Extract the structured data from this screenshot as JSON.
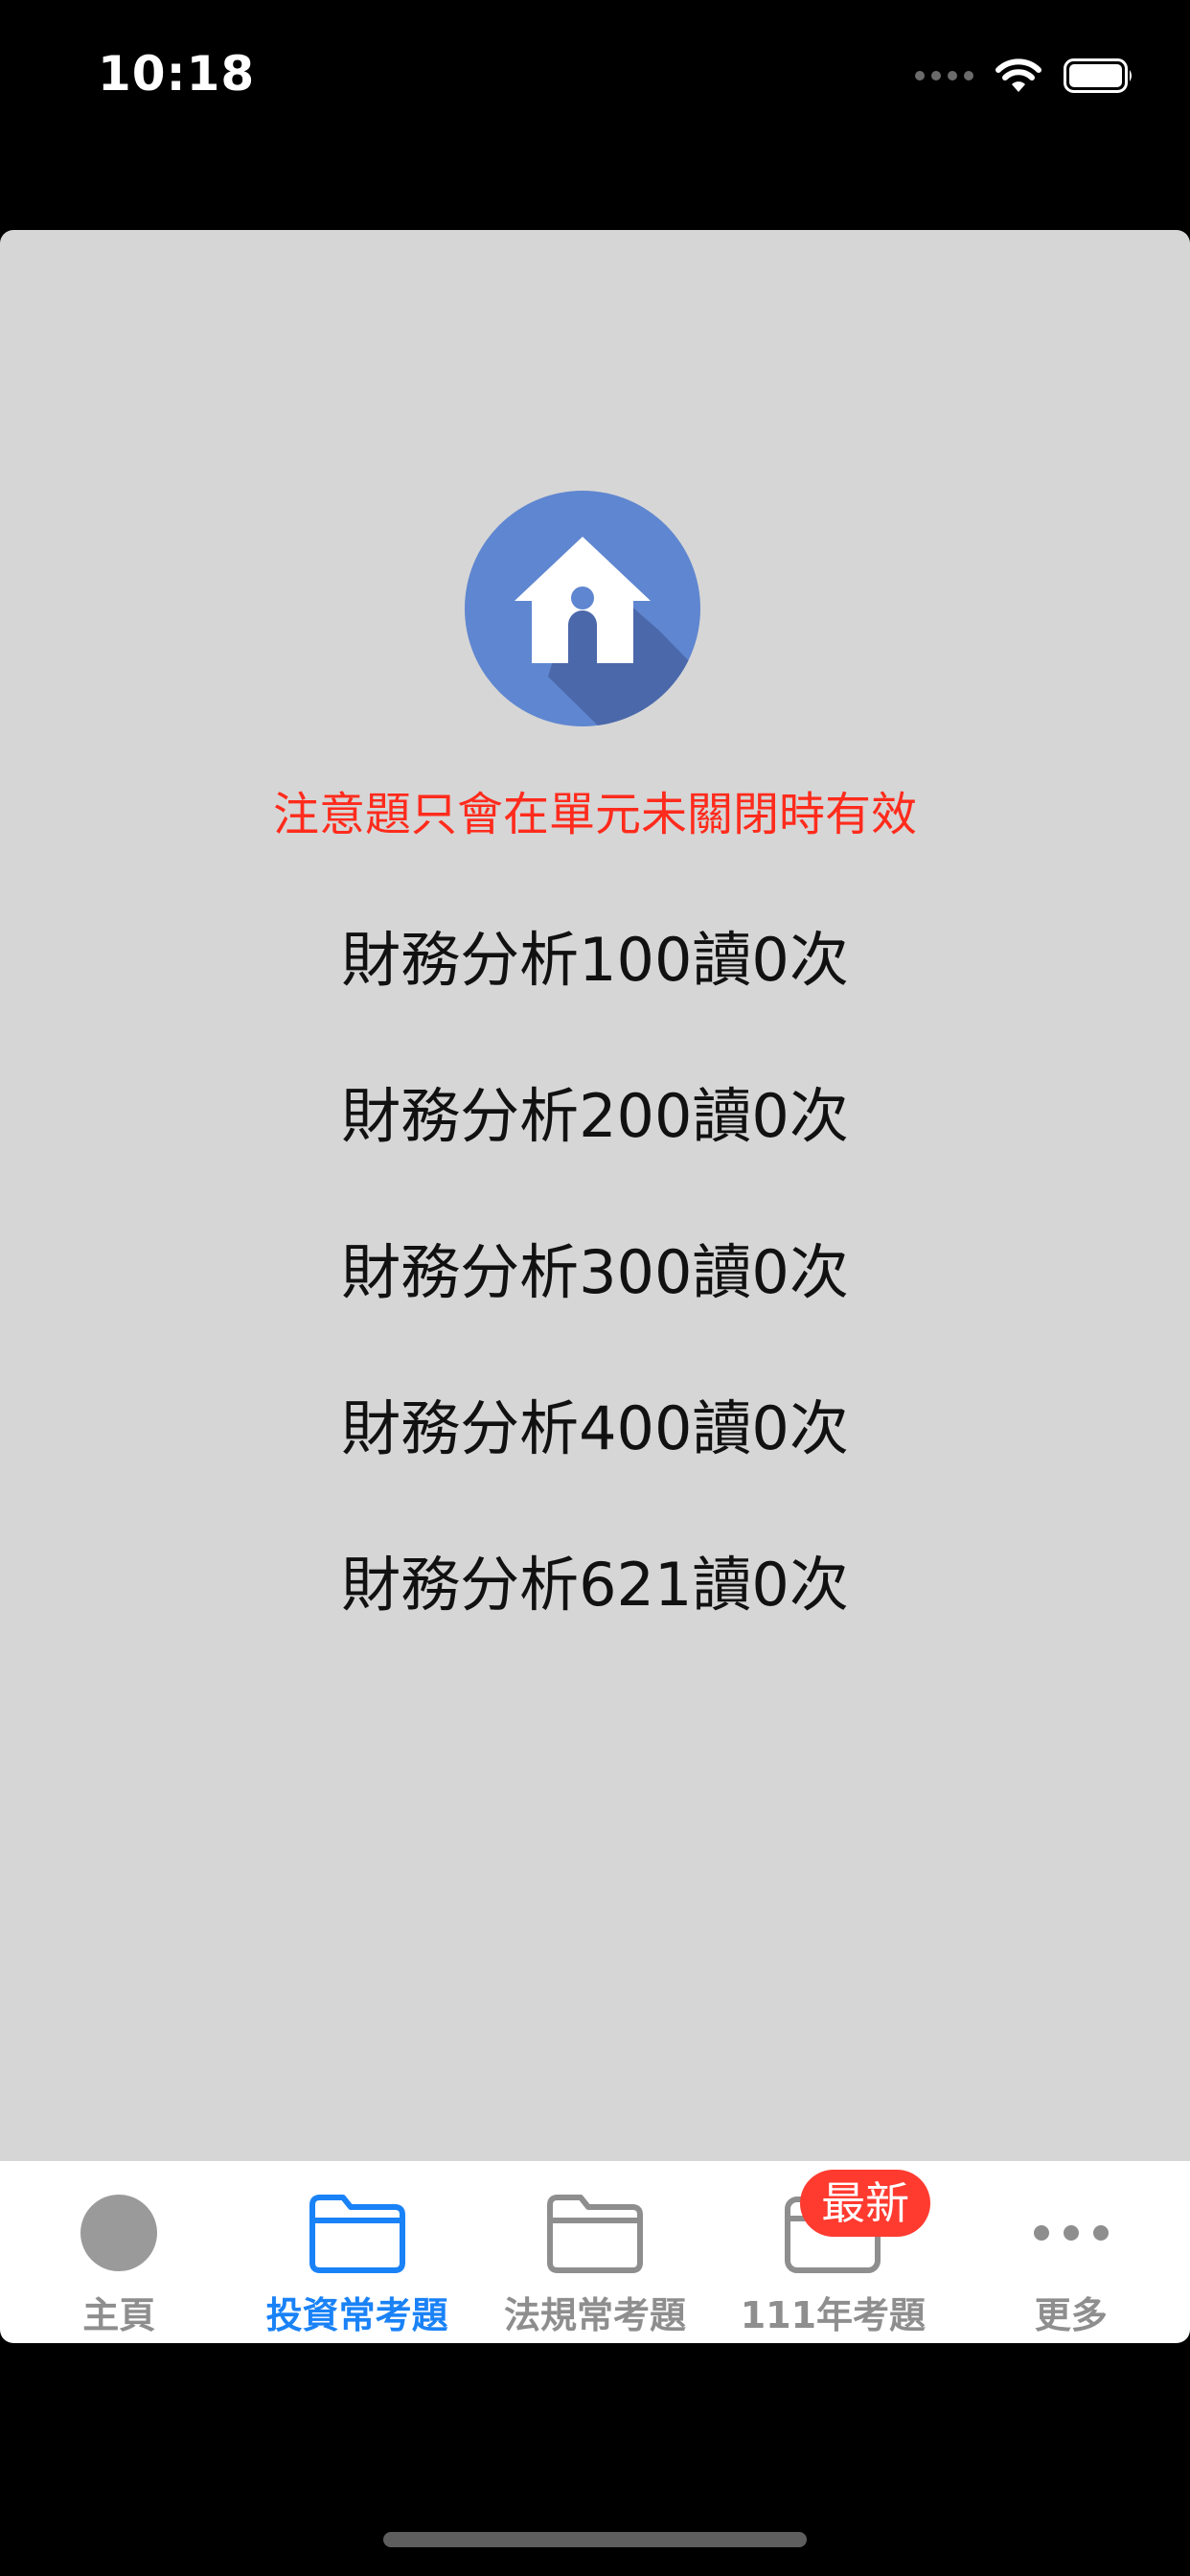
{
  "status_bar": {
    "time": "10:18"
  },
  "notice": "注意題只會在單元未關閉時有效",
  "read_items": [
    {
      "label": "財務分析100讀0次"
    },
    {
      "label": "財務分析200讀0次"
    },
    {
      "label": "財務分析300讀0次"
    },
    {
      "label": "財務分析400讀0次"
    },
    {
      "label": "財務分析621讀0次"
    }
  ],
  "tabs": [
    {
      "label": "主頁",
      "icon": "circle-icon",
      "active": false
    },
    {
      "label": "投資常考題",
      "icon": "folder-icon",
      "active": true
    },
    {
      "label": "法規常考題",
      "icon": "folder-icon",
      "active": false
    },
    {
      "label": "111年考題",
      "icon": "calendar-icon",
      "active": false,
      "badge": "最新"
    },
    {
      "label": "更多",
      "icon": "more-icon",
      "active": false
    }
  ],
  "colors": {
    "accent": "#1a82f7",
    "notice": "#ff2b1c",
    "badge": "#ff3b30",
    "sheet_background": "#d6d6d6",
    "inactive": "#8e8e8e"
  }
}
